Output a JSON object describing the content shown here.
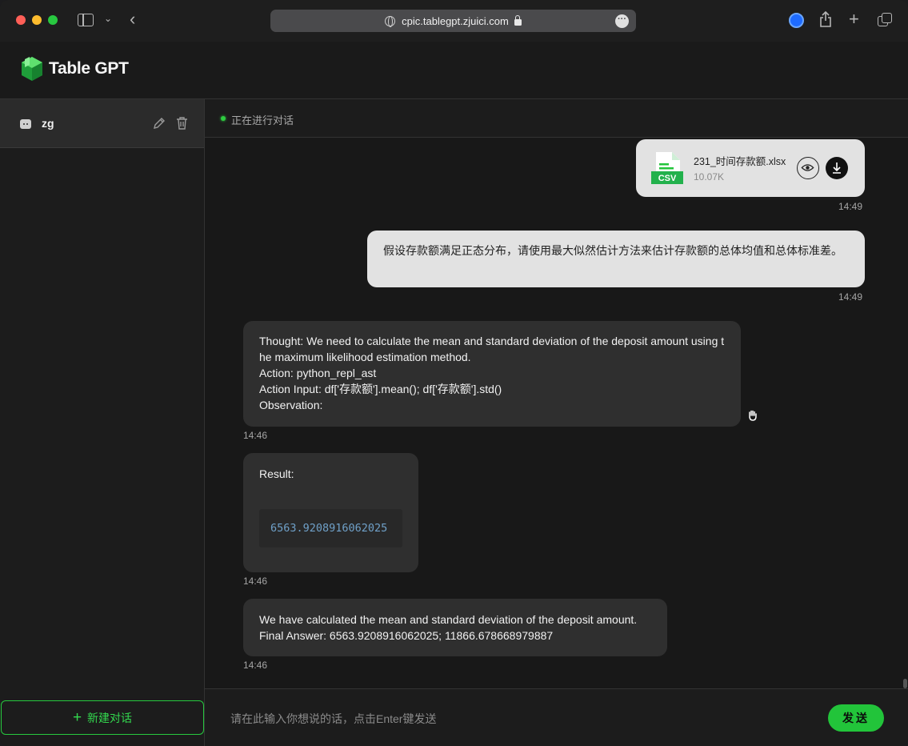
{
  "browser": {
    "url": "cpic.tablegpt.zjuici.com"
  },
  "app": {
    "title": "Table GPT"
  },
  "sidebar": {
    "conversations": [
      {
        "name": "zg"
      }
    ],
    "new_chat_label": "新建对话"
  },
  "main": {
    "status": "正在进行对话",
    "messages": {
      "file": {
        "name": "231_时间存款额.xlsx",
        "size": "10.07K",
        "badge": "CSV",
        "time": "14:49"
      },
      "question": {
        "text": "假设存款额满足正态分布，请使用最大似然估计方法来估计存款额的总体均值和总体标准差。",
        "time": "14:49"
      },
      "thought": {
        "text": "Thought: We need to calculate the mean and standard deviation of the deposit amount using the maximum likelihood estimation method.\nAction: python_repl_ast\nAction Input: df['存款额'].mean(); df['存款额'].std()\nObservation:",
        "time": "14:46"
      },
      "result": {
        "label": "Result:",
        "code": "6563.9208916062025",
        "time": "14:46"
      },
      "final": {
        "text": "We have calculated the mean and standard deviation of the deposit amount.\nFinal Answer: 6563.9208916062025; 11866.678668979887",
        "time": "14:46"
      }
    },
    "input": {
      "placeholder": "请在此输入你想说的话，点击Enter键发送",
      "send_label": "发送"
    }
  },
  "colors": {
    "accent": "#22c43a",
    "code": "#6fa0c8"
  }
}
